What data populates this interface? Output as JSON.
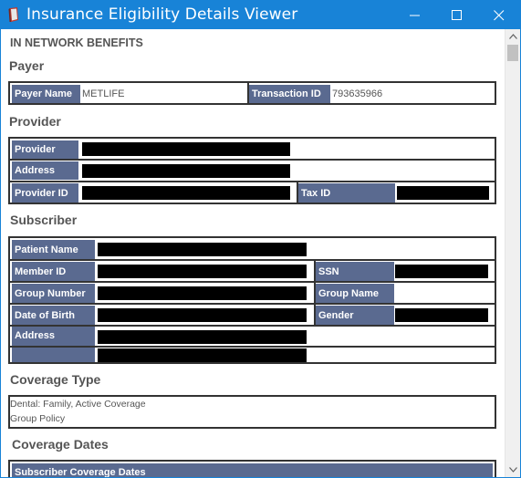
{
  "window": {
    "title": "Insurance Eligibility Details Viewer",
    "icon": "book-icon",
    "controls": [
      "minimize-icon",
      "maximize-icon",
      "close-icon"
    ]
  },
  "colors": {
    "titlebar": "#1883d7",
    "label_bg": "#5a6a90",
    "label_text": "#ffffff",
    "heading_text": "#555555",
    "redaction": "#000000"
  },
  "main_heading": "IN NETWORK BENEFITS",
  "payer": {
    "title": "Payer",
    "payer_name_label": "Payer Name",
    "payer_name_value": "METLIFE",
    "transaction_id_label": "Transaction ID",
    "transaction_id_value": "793635966"
  },
  "provider": {
    "title": "Provider",
    "provider_label": "Provider",
    "address_label": "Address",
    "provider_id_label": "Provider ID",
    "tax_id_label": "Tax ID"
  },
  "subscriber": {
    "title": "Subscriber",
    "patient_name_label": "Patient Name",
    "member_id_label": "Member ID",
    "ssn_label": "SSN",
    "group_number_label": "Group Number",
    "group_name_label": "Group Name",
    "dob_label": "Date of Birth",
    "gender_label": "Gender",
    "address_label": "Address"
  },
  "coverage_type": {
    "title": "Coverage Type",
    "line1": "Dental: Family, Active Coverage",
    "line2": "Group Policy"
  },
  "coverage_dates": {
    "title": "Coverage Dates",
    "subscriber_coverage_label": "Subscriber Coverage Dates"
  }
}
